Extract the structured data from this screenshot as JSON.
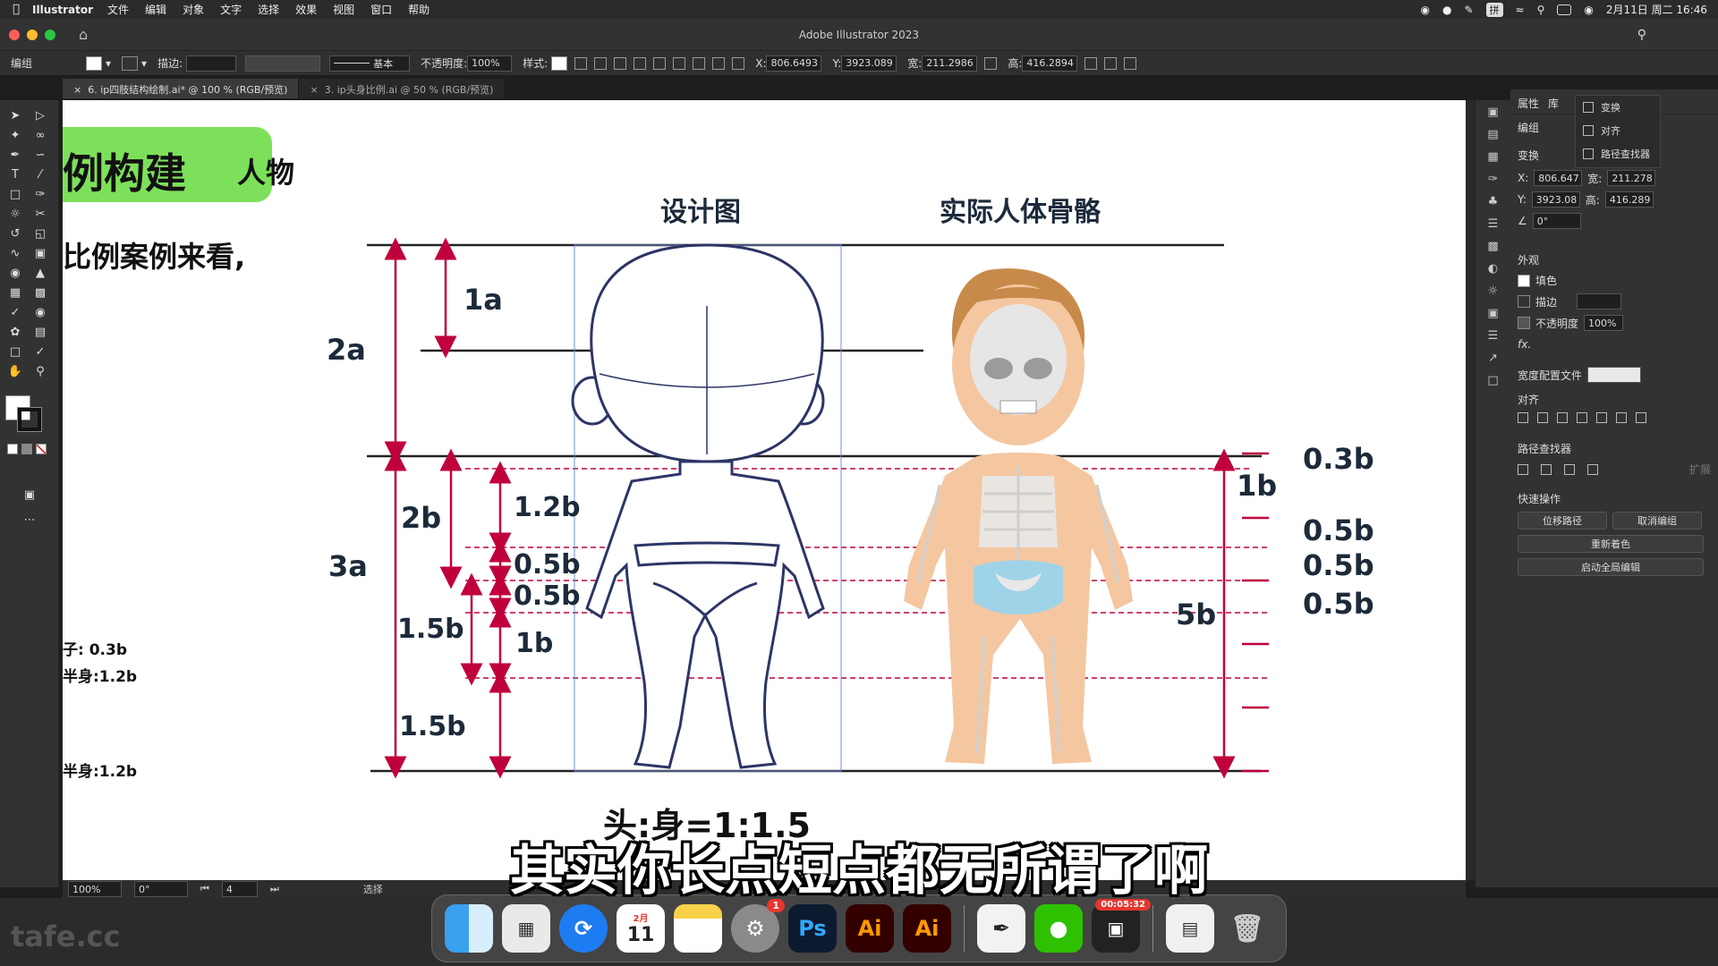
{
  "menubar": {
    "app": "Illustrator",
    "items": [
      "文件",
      "编辑",
      "对象",
      "文字",
      "选择",
      "效果",
      "视图",
      "窗口",
      "帮助"
    ],
    "ime": "拼",
    "datetime": "2月11日 周二 16:46"
  },
  "window": {
    "title": "Adobe Illustrator 2023"
  },
  "controlbar": {
    "group_label": "编组",
    "stroke_label": "描边:",
    "stroke_style": "基本",
    "opacity_label": "不透明度:",
    "opacity_value": "100%",
    "style_label": "样式:",
    "x_label": "X:",
    "x_value": "806.6493",
    "y_label": "Y:",
    "y_value": "3923.089",
    "w_label": "宽:",
    "w_value": "211.2986",
    "h_label": "高:",
    "h_value": "416.2894"
  },
  "tabs": [
    {
      "label": "6. ip四肢结构绘制.ai* @ 100 % (RGB/预览)"
    },
    {
      "label": "3. ip头身比例.ai @ 50 % (RGB/预览)"
    }
  ],
  "canvas": {
    "heading_green": "例构建",
    "heading_right": "人物",
    "left_text": "比例案例来看,",
    "col_design": "设计图",
    "col_actual": "实际人体骨骼",
    "note1": "子: 0.3b",
    "note2": "半身:1.2b",
    "note3": "半身:1.2b",
    "labels": {
      "a1": "1a",
      "a2": "2a",
      "a3": "3a",
      "b2": "2b",
      "b12": "1.2b",
      "b05a": "0.5b",
      "b05b": "0.5b",
      "b15a": "1.5b",
      "b1": "1b",
      "b15b": "1.5b",
      "r03": "0.3b",
      "r1b": "1b",
      "r05a": "0.5b",
      "r05b": "0.5b",
      "r05c": "0.5b",
      "r5b": "5b"
    },
    "ratio": "头:身=1:1.5"
  },
  "subtitle": "其实你长点短点都无所谓了啊",
  "props": {
    "tab1": "属性",
    "tab2": "库",
    "group": "编组",
    "transform": "变换",
    "x_label": "X:",
    "x": "806.647",
    "w_label": "宽:",
    "w": "211.278",
    "y_label": "Y:",
    "y": "3923.08",
    "h_label": "高:",
    "h": "416.289",
    "angle": "0°",
    "appearance": "外观",
    "fill": "填色",
    "stroke": "描边",
    "opacity": "不透明度",
    "opacity_value": "100%",
    "width_profile": "宽度配置文件",
    "align": "对齐",
    "pathfinder": "路径查找器",
    "expand": "扩展",
    "quick_actions": "快速操作",
    "offset_path": "位移路径",
    "ungroup": "取消编组",
    "recolor": "重新着色",
    "global_edit": "启动全局编辑"
  },
  "floatpanel": {
    "items": [
      "变换",
      "对齐",
      "路径查找器"
    ]
  },
  "statusbar": {
    "zoom": "100%",
    "angle": "0°",
    "artboard": "4",
    "tool": "选择"
  },
  "dock": {
    "apps": [
      "Finder",
      "Launchpad",
      "Safari",
      "Calendar",
      "Notes",
      "Settings",
      "Ps",
      "Ai",
      "Ai",
      "Pen",
      "WeChat",
      "Recorder",
      "Preview",
      "Trash"
    ],
    "calendar_month": "2月",
    "calendar_day": "11",
    "settings_badge": "1",
    "recorder_time": "00:05:32"
  },
  "watermark": "tafe.cc",
  "colors": {
    "dimension": "#c0003c",
    "outline": "#2d3566",
    "green": "#7de05a",
    "navy_text": "#1c2a3a"
  }
}
